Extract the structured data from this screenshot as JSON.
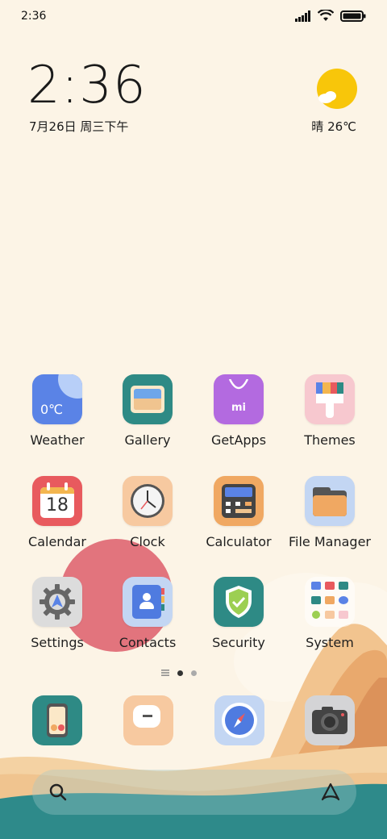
{
  "status_bar": {
    "time": "2:36"
  },
  "clock_widget": {
    "time": "2:36",
    "date": "7月26日 周三下午"
  },
  "weather_widget": {
    "text": "晴 26℃"
  },
  "apps": {
    "weather": {
      "label": "Weather",
      "tile_text": "0℃"
    },
    "gallery": {
      "label": "Gallery"
    },
    "getapps": {
      "label": "GetApps",
      "tile_text": "mi"
    },
    "themes": {
      "label": "Themes"
    },
    "calendar": {
      "label": "Calendar",
      "tile_text": "18"
    },
    "clock": {
      "label": "Clock"
    },
    "calculator": {
      "label": "Calculator"
    },
    "file_manager": {
      "label": "File Manager"
    },
    "settings": {
      "label": "Settings"
    },
    "contacts": {
      "label": "Contacts"
    },
    "security": {
      "label": "Security"
    },
    "system": {
      "label": "System"
    }
  },
  "colors": {
    "background": "#fcf4e6",
    "weather": "#5a83e6",
    "gallery": "#2e8a85",
    "getapps": "#b36ae0",
    "themes": "#f7c8cf",
    "calendar": "#e85a5e",
    "clock": "#f7c9a0",
    "calculator": "#f0a862",
    "file_manager": "#c3d6f3",
    "settings": "#dcdcdc",
    "contacts": "#c3d6f3",
    "security": "#2e8a85",
    "dock_phone": "#2e8a85",
    "dock_messages": "#f7c9a0",
    "dock_browser": "#c3d6f3",
    "dock_camera": "#d4d4d6"
  },
  "dock": [
    "phone-app",
    "messages-app",
    "browser-app",
    "camera-app"
  ],
  "page_indicator": {
    "count": 2,
    "active": 0
  }
}
